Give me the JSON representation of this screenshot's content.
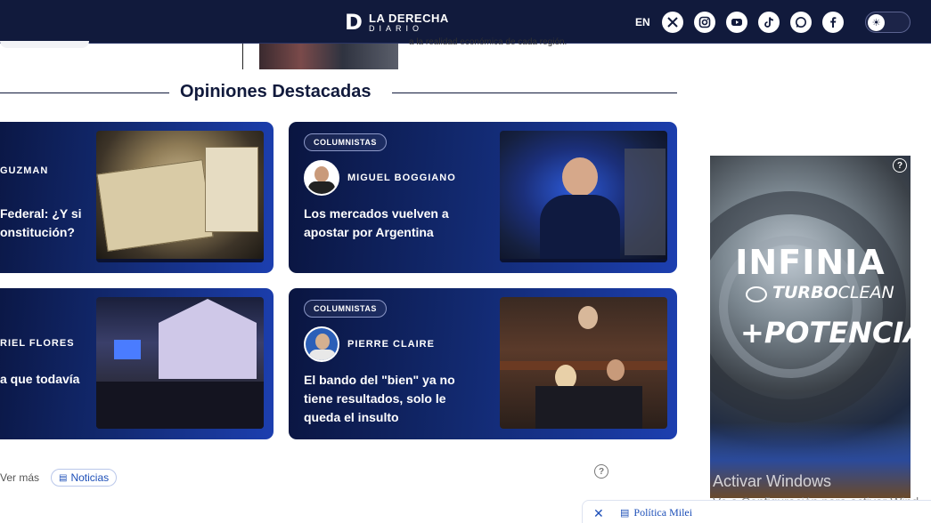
{
  "header": {
    "logo_line1": "LA DERECHA",
    "logo_line2": "DIARIO",
    "language": "EN",
    "social": [
      "x-icon",
      "instagram-icon",
      "youtube-icon",
      "tiktok-icon",
      "whatsapp-icon",
      "facebook-icon"
    ],
    "theme_icon": "☀"
  },
  "top": {
    "snippet": "a la realidad económica de cada región."
  },
  "section": {
    "title": "Opiniones Destacadas"
  },
  "cards": [
    {
      "badge": "",
      "author": "GUZMAN",
      "headline": "Federal: ¿Y si\nonstitución?"
    },
    {
      "badge": "COLUMNISTAS",
      "author": "MIGUEL BOGGIANO",
      "headline": "Los mercados vuelven a\napostar por Argentina"
    },
    {
      "badge": "",
      "author": "RIEL FLORES",
      "headline": "a que todavía"
    },
    {
      "badge": "COLUMNISTAS",
      "author": "PIERRE CLAIRE",
      "headline": "El bando del \"bien\" ya no\ntiene resultados, solo le\nqueda el insulto"
    }
  ],
  "footer": {
    "ver_mas": "Ver más",
    "tag": "Noticias"
  },
  "ad": {
    "line1": "INFINIA",
    "line2_bold": "TURBO",
    "line2_light": "CLEAN",
    "line3": "+POTENCIA"
  },
  "windows": {
    "line1": "Activar Windows",
    "line2": "Ve a Configuración para activar Wind"
  },
  "bottom_bar": {
    "close": "✕",
    "link": "Política Milei"
  },
  "colors": {
    "header_bg": "#111a3c",
    "card_gradient_start": "#0a1540",
    "card_gradient_end": "#1c3fb0",
    "link_blue": "#1d4fb8"
  }
}
